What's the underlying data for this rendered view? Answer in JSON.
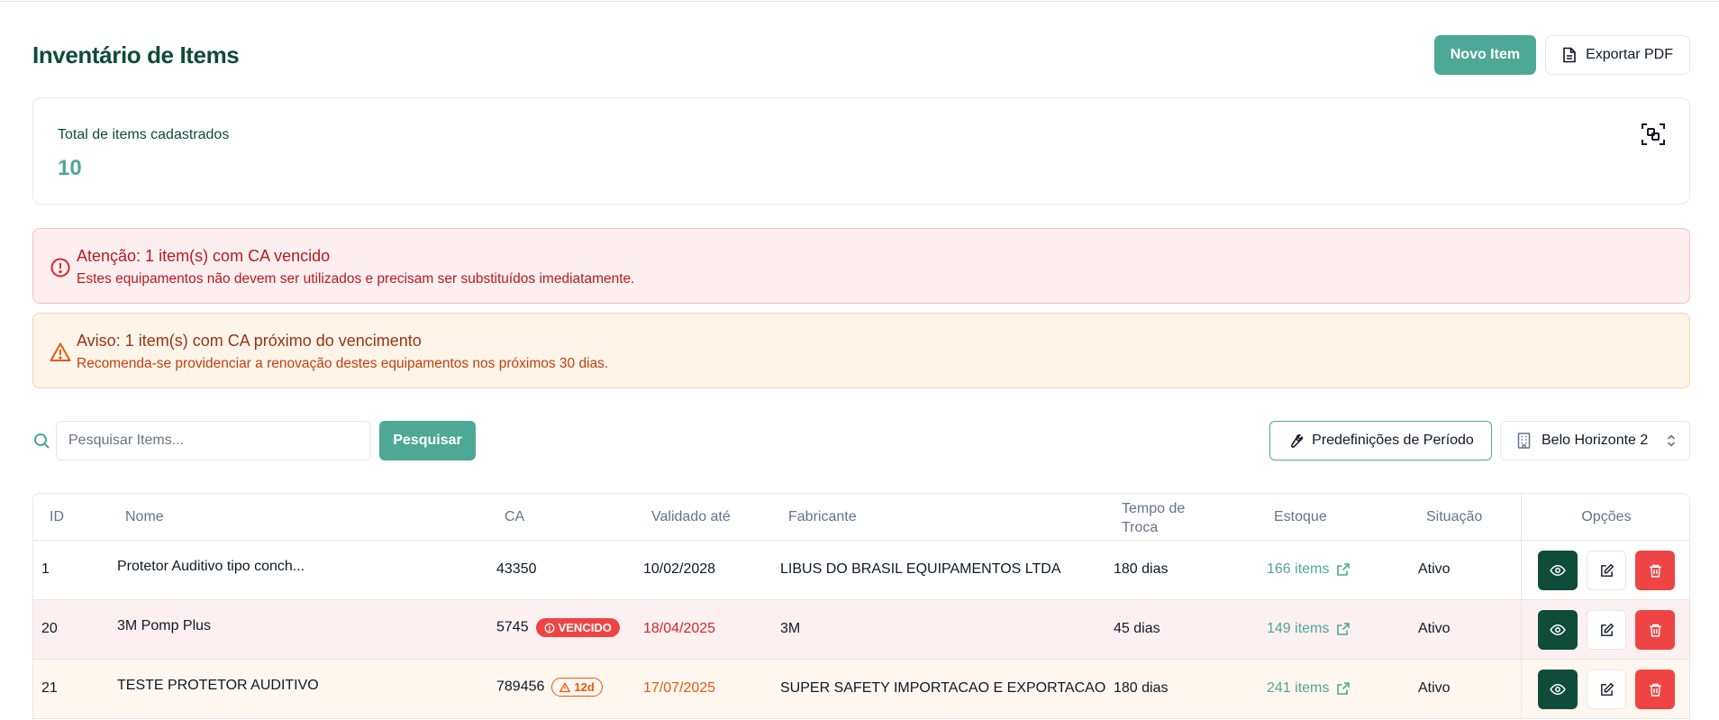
{
  "header": {
    "title": "Inventário de Items",
    "new_item_label": "Novo Item",
    "export_label": "Exportar PDF"
  },
  "stats": {
    "label": "Total de items cadastrados",
    "value": "10"
  },
  "alerts": {
    "danger": {
      "title": "Atenção: 1 item(s) com CA vencido",
      "text": "Estes equipamentos não devem ser utilizados e precisam ser substituídos imediatamente."
    },
    "warning": {
      "title": "Aviso: 1 item(s) com CA próximo do vencimento",
      "text": "Recomenda-se providenciar a renovação destes equipamentos nos próximos 30 dias."
    }
  },
  "toolbar": {
    "search_placeholder": "Pesquisar Items...",
    "search_button": "Pesquisar",
    "period_button": "Predefinições de Período",
    "unit_select": "Belo Horizonte 2"
  },
  "table": {
    "headers": {
      "id": "ID",
      "nome": "Nome",
      "ca": "CA",
      "validade": "Validado até",
      "fabricante": "Fabricante",
      "tempo_line1": "Tempo de",
      "tempo_line2": "Troca",
      "estoque": "Estoque",
      "situacao": "Situação",
      "opcoes": "Opções"
    },
    "rows": [
      {
        "id": "1",
        "nome": "Protetor Auditivo tipo conch...",
        "ca": "43350",
        "badge": "",
        "validade": "10/02/2028",
        "fabricante": "LIBUS DO BRASIL EQUIPAMENTOS LTDA",
        "tempo": "180 dias",
        "estoque": "166 items",
        "situacao": "Ativo"
      },
      {
        "id": "20",
        "nome": "3M Pomp Plus",
        "ca": "5745",
        "badge": "VENCIDO",
        "validade": "18/04/2025",
        "fabricante": "3M",
        "tempo": "45 dias",
        "estoque": "149 items",
        "situacao": "Ativo"
      },
      {
        "id": "21",
        "nome": "TESTE PROTETOR AUDITIVO",
        "ca": "789456",
        "badge": "12d",
        "validade": "17/07/2025",
        "fabricante": "SUPER SAFETY IMPORTACAO E EXPORTACAO",
        "tempo": "180 dias",
        "estoque": "241 items",
        "situacao": "Ativo"
      }
    ]
  },
  "colors": {
    "brand": "#4ea896",
    "brand_dark": "#0f4c3a",
    "danger": "#ef4444",
    "warning": "#ea580c"
  },
  "icons": [
    "file-icon",
    "scan-icon",
    "alert-circle-icon",
    "alert-triangle-icon",
    "search-icon",
    "wrench-icon",
    "building-icon",
    "chevrons-updown-icon",
    "external-link-icon",
    "eye-icon",
    "edit-icon",
    "trash-icon"
  ]
}
